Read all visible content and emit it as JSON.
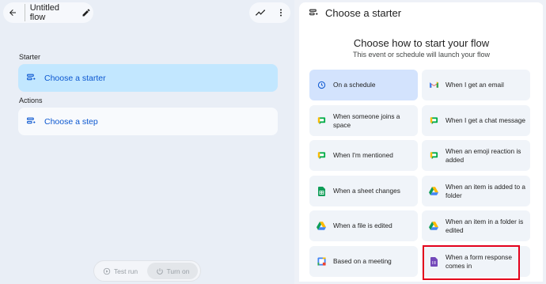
{
  "header": {
    "flow_title": "Untitled flow"
  },
  "left": {
    "starter_label": "Starter",
    "starter_card": "Choose a starter",
    "actions_label": "Actions",
    "step_card": "Choose a step"
  },
  "bottom": {
    "test_run": "Test run",
    "turn_on": "Turn on"
  },
  "panel": {
    "header": "Choose a starter",
    "title": "Choose how to start your flow",
    "subtitle": "This event or schedule will launch your flow",
    "options": [
      {
        "label": "On a schedule",
        "icon": "clock-icon"
      },
      {
        "label": "When I get an email",
        "icon": "gmail-icon"
      },
      {
        "label": "When someone joins a space",
        "icon": "chat-icon"
      },
      {
        "label": "When I get a chat message",
        "icon": "chat-icon"
      },
      {
        "label": "When I'm mentioned",
        "icon": "chat-icon"
      },
      {
        "label": "When an emoji reaction is added",
        "icon": "chat-icon"
      },
      {
        "label": "When a sheet changes",
        "icon": "sheets-icon"
      },
      {
        "label": "When an item is added to a folder",
        "icon": "drive-icon"
      },
      {
        "label": "When a file is edited",
        "icon": "drive-icon"
      },
      {
        "label": "When an item in a folder is edited",
        "icon": "drive-icon"
      },
      {
        "label": "Based on a meeting",
        "icon": "calendar-icon"
      },
      {
        "label": "When a form response comes in",
        "icon": "forms-icon"
      }
    ]
  },
  "colors": {
    "accent": "#0b57d0",
    "selected": "#c2e7ff",
    "highlight": "#e3001b"
  }
}
